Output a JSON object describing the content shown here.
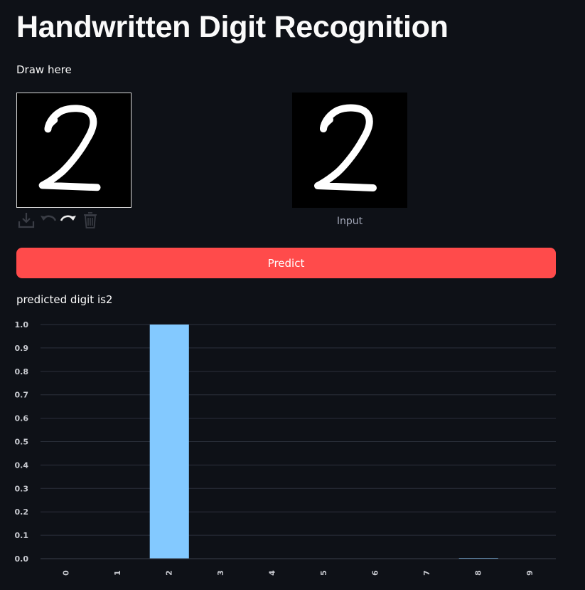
{
  "app": {
    "title": "Handwritten Digit Recognition",
    "draw_label": "Draw here",
    "input_caption": "Input",
    "predict_label": "Predict",
    "result_text": "predicted digit is2"
  },
  "toolbar": {
    "icons": [
      "download-icon",
      "undo-icon",
      "redo-icon",
      "trash-icon"
    ]
  },
  "colors": {
    "background": "#0e1117",
    "button": "#ff4b4b",
    "bar": "#83c9ff",
    "grid": "#2c313c"
  },
  "chart_data": {
    "type": "bar",
    "categories": [
      "0",
      "1",
      "2",
      "3",
      "4",
      "5",
      "6",
      "7",
      "8",
      "9"
    ],
    "values": [
      0.0,
      0.0,
      1.0,
      0.0,
      0.0,
      0.0,
      0.0,
      0.0,
      0.003,
      0.0
    ],
    "yticks": [
      "0.0",
      "0.1",
      "0.2",
      "0.3",
      "0.4",
      "0.5",
      "0.6",
      "0.7",
      "0.8",
      "0.9",
      "1.0"
    ],
    "ylim": [
      0,
      1.0
    ],
    "grid": true,
    "legend": "none"
  }
}
